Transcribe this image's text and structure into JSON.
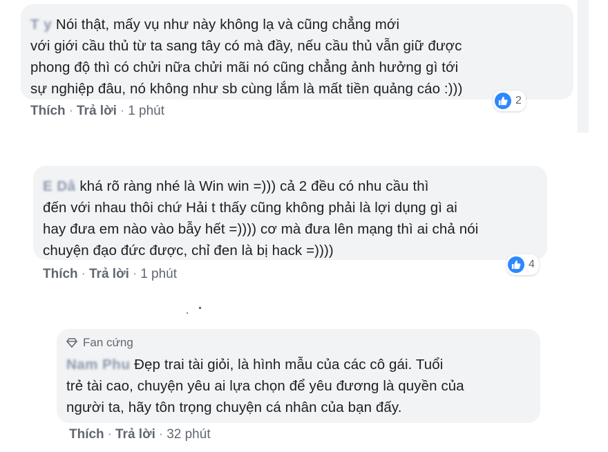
{
  "comments": [
    {
      "author": "T      y",
      "text": "Nói thật, mấy vụ như này không lạ và cũng chẳng mới\nvới giới cầu thủ từ ta sang tây có mà đầy, nếu cầu thủ vẫn giữ được\nphong độ thì có chửi nữa chửi mãi nó cũng chẳng ảnh hưởng gì tới\nsự nghiệp đâu, nó không như sb cùng lắm là mất tiền quảng cáo :)))",
      "like_label": "Thích",
      "reply_label": "Trả lời",
      "time": "1 phút",
      "reaction_count": "2",
      "reaction_icon": "like-icon"
    },
    {
      "author": "E      Dâ",
      "text": "khá rõ ràng nhé là Win win =))) cả 2 đều có nhu cầu thì\nđến với nhau thôi chứ Hải t thấy cũng không phải là lợi dụng gì ai\nhay đưa em nào vào bẫy hết =)))) cơ mà đưa lên mạng thì ai chả nói\nchuyện đạo đức được, chỉ đen là bị hack =))))",
      "like_label": "Thích",
      "reply_label": "Trả lời",
      "time": "1 phút",
      "reaction_count": "4",
      "reaction_icon": "like-icon"
    },
    {
      "badge": "Fan cứng",
      "badge_icon": "diamond-icon",
      "author": "Nam Phu",
      "text": "Đẹp trai tài giỏi, là hình mẫu của các cô gái. Tuổi\ntrẻ tài cao, chuyện yêu ai lựa chọn để yêu đương là quyền của\nngười ta, hãy tôn trọng chuyện cá nhân của bạn đấy.",
      "like_label": "Thích",
      "reply_label": "Trả lời",
      "time": "32 phút"
    }
  ],
  "colors": {
    "bubble": "#f2f3f5",
    "author": "#385898",
    "meta": "#606770",
    "like_blue": "#2d88ff"
  }
}
